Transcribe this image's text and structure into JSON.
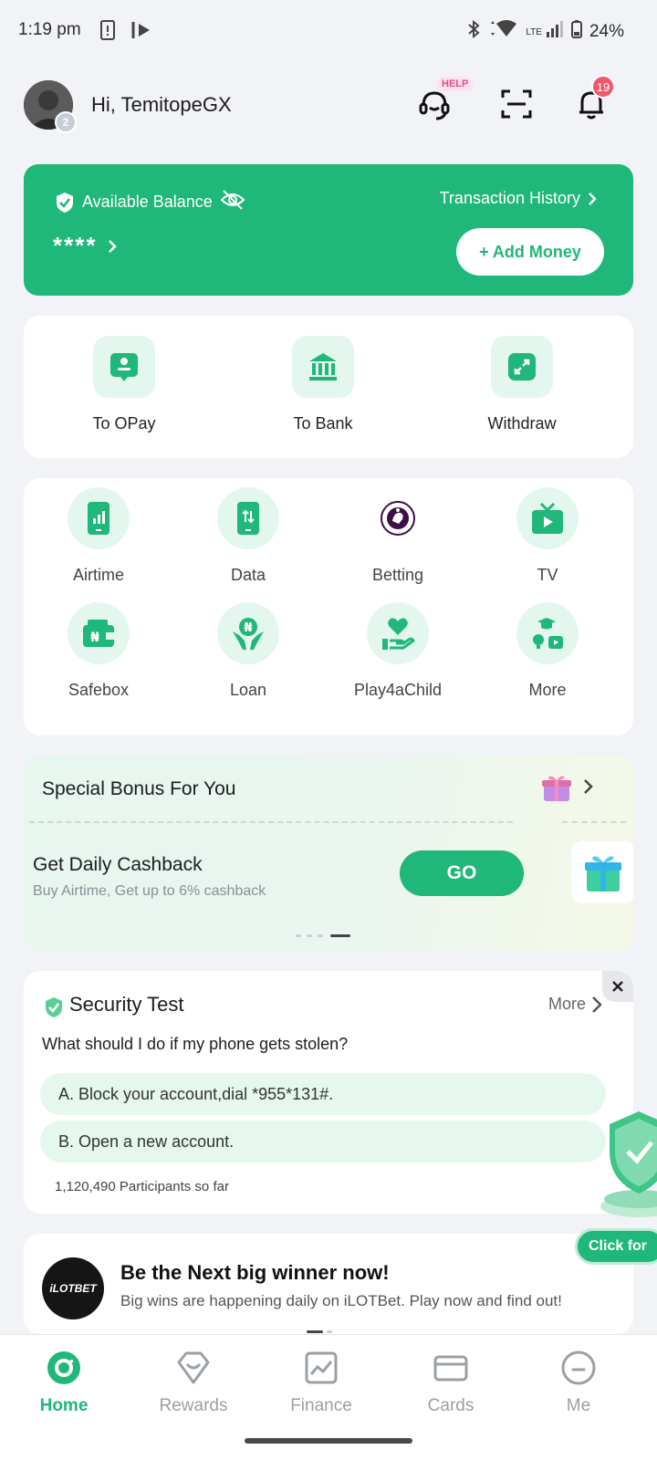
{
  "status_bar": {
    "time": "1:19 pm",
    "network": "LTE",
    "battery": "24%"
  },
  "header": {
    "greeting": "Hi, TemitopeGX",
    "avatar_level": "2",
    "help_tag": "HELP",
    "notification_count": "19"
  },
  "balance": {
    "label": "Available Balance",
    "history_label": "Transaction History",
    "masked_value": "****",
    "add_money_label": "+ Add Money"
  },
  "transfers": [
    {
      "label": "To OPay",
      "icon": "person-card-icon"
    },
    {
      "label": "To Bank",
      "icon": "bank-icon"
    },
    {
      "label": "Withdraw",
      "icon": "withdraw-arrows-icon"
    }
  ],
  "services": [
    {
      "label": "Airtime",
      "icon": "phone-signal-icon"
    },
    {
      "label": "Data",
      "icon": "phone-data-icon"
    },
    {
      "label": "Betting",
      "icon": "premier-league-icon"
    },
    {
      "label": "TV",
      "icon": "tv-play-icon"
    },
    {
      "label": "Safebox",
      "icon": "wallet-naira-icon"
    },
    {
      "label": "Loan",
      "icon": "hands-naira-icon"
    },
    {
      "label": "Play4aChild",
      "icon": "hand-heart-icon"
    },
    {
      "label": "More",
      "icon": "more-services-icon"
    }
  ],
  "bonus": {
    "title": "Special Bonus For You",
    "cashback_title": "Get Daily Cashback",
    "cashback_sub": "Buy Airtime, Get up to 6% cashback",
    "go_label": "GO",
    "pager_total": 4,
    "pager_active": 4
  },
  "security": {
    "title": "Security Test",
    "more_label": "More",
    "question": "What should I do if my phone gets stolen?",
    "answers": [
      "A. Block your account,dial *955*131#.",
      "B. Open a new account."
    ],
    "participants": "1,120,490 Participants so far"
  },
  "floating": {
    "pill_label": "Click for"
  },
  "promo": {
    "logo_text": "iLOTBET",
    "title": "Be the Next big winner now!",
    "subtitle": "Big wins are happening daily on iLOTBet. Play now and find out!"
  },
  "bottom_nav": [
    {
      "label": "Home",
      "active": true
    },
    {
      "label": "Rewards",
      "active": false
    },
    {
      "label": "Finance",
      "active": false
    },
    {
      "label": "Cards",
      "active": false
    },
    {
      "label": "Me",
      "active": false
    }
  ],
  "colors": {
    "brand_green": "#1fb77a",
    "tile_green": "#e3f7ee",
    "badge_red": "#f2576b",
    "help_pink": "#e64a8a"
  }
}
